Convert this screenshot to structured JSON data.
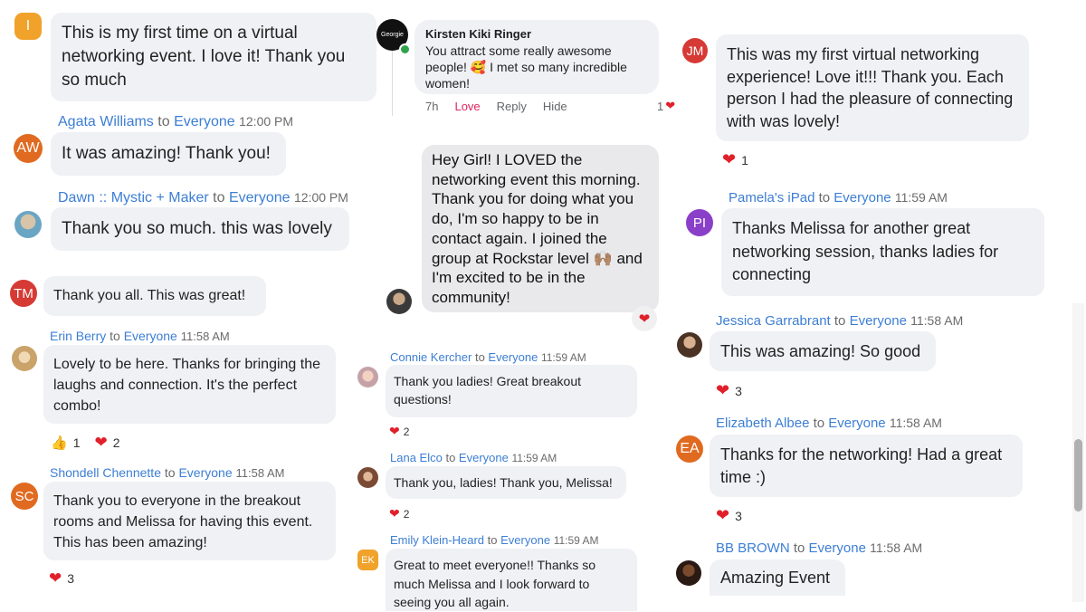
{
  "col1": {
    "msg0": {
      "avatar": "I",
      "avatar_color": "#f0a22a",
      "text": "This is my first time on a virtual networking event. I love it! Thank you so much"
    },
    "msg1": {
      "name": "Agata Williams",
      "to": "to",
      "audience": "Everyone",
      "time": "12:00 PM",
      "avatar": "AW",
      "avatar_color": "#e06a20",
      "text": "It was amazing! Thank you!"
    },
    "msg2": {
      "name": "Dawn :: Mystic + Maker",
      "to": "to",
      "audience": "Everyone",
      "time": "12:00 PM",
      "text": "Thank you so much.  this was lovely"
    },
    "msg3": {
      "avatar": "TM",
      "avatar_color": "#d63a35",
      "text": "Thank you all. This was great!"
    },
    "msg4": {
      "name": "Erin Berry",
      "to": "to",
      "audience": "Everyone",
      "time": "11:58 AM",
      "text": "Lovely to be here.  Thanks for bringing the laughs and connection.  It's the perfect combo!",
      "like_count": "1",
      "heart_count": "2"
    },
    "msg5": {
      "name": "Shondell Chennette",
      "to": "to",
      "audience": "Everyone",
      "time": "11:58 AM",
      "avatar": "SC",
      "avatar_color": "#e06a20",
      "text": "Thank you to everyone in the breakout rooms and Melissa for having this event. This has been amazing!",
      "heart_count": "3"
    }
  },
  "col2": {
    "fb": {
      "name": "Kirsten Kiki Ringer",
      "text": "You attract some really awesome people! 🥰 I met so many incredible women!",
      "time": "7h",
      "love": "Love",
      "reply": "Reply",
      "hide": "Hide",
      "count": "1",
      "avatar_text": "Georgie"
    },
    "sms": {
      "text": "Hey Girl! I LOVED the networking event this morning. Thank you for doing what you do, I'm so happy to be in contact again. I joined the group at Rockstar level 🙌🏽 and I'm excited to be in the community!"
    },
    "msg1": {
      "name": "Connie Kercher",
      "to": "to",
      "audience": "Everyone",
      "time": "11:59 AM",
      "text": "Thank you ladies! Great breakout questions!",
      "heart_count": "2"
    },
    "msg2": {
      "name": "Lana Elco",
      "to": "to",
      "audience": "Everyone",
      "time": "11:59 AM",
      "text": "Thank you, ladies! Thank you, Melissa!",
      "heart_count": "2"
    },
    "msg3": {
      "name": "Emily Klein-Heard",
      "to": "to",
      "audience": "Everyone",
      "time": "11:59 AM",
      "avatar": "EK",
      "avatar_color": "#f0a22a",
      "text": "Great to meet everyone!! Thanks so much Melissa and I look forward to seeing you all again."
    }
  },
  "col3": {
    "msg0": {
      "avatar": "JM",
      "avatar_color": "#d63a35",
      "text": "This was my first virtual networking experience!  Love it!!!  Thank you. Each person I had the pleasure of connecting with was lovely!",
      "heart_count": "1"
    },
    "msg1": {
      "name": "Pamela's iPad",
      "to": "to",
      "audience": "Everyone",
      "time": "11:59 AM",
      "avatar": "PI",
      "avatar_color": "#8a3fc9",
      "text": "Thanks Melissa for another great networking session, thanks ladies for connecting"
    },
    "msg2": {
      "name": "Jessica Garrabrant",
      "to": "to",
      "audience": "Everyone",
      "time": "11:58 AM",
      "text": "This was amazing! So good",
      "heart_count": "3"
    },
    "msg3": {
      "name": "Elizabeth Albee",
      "to": "to",
      "audience": "Everyone",
      "time": "11:58 AM",
      "avatar": "EA",
      "avatar_color": "#e06a20",
      "text": "Thanks for the networking! Had a great time :)",
      "heart_count": "3"
    },
    "msg4": {
      "name": "BB BROWN",
      "to": "to",
      "audience": "Everyone",
      "time": "11:58 AM",
      "text": "Amazing Event"
    }
  },
  "icons": {
    "heart": "❤",
    "like": "👍"
  }
}
